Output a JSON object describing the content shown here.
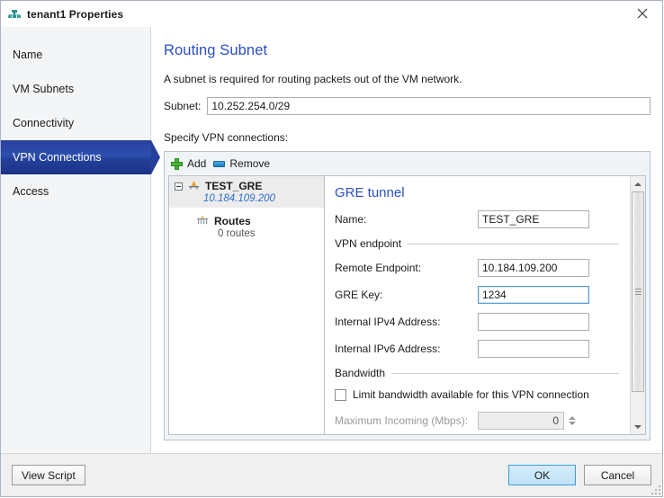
{
  "window": {
    "title": "tenant1 Properties",
    "icon": "network-tenant-icon",
    "close_label": "✕"
  },
  "sidebar": {
    "items": [
      {
        "label": "Name",
        "selected": false
      },
      {
        "label": "VM Subnets",
        "selected": false
      },
      {
        "label": "Connectivity",
        "selected": false
      },
      {
        "label": "VPN Connections",
        "selected": true
      },
      {
        "label": "Access",
        "selected": false
      }
    ]
  },
  "main": {
    "title": "Routing Subnet",
    "description": "A subnet is required for routing packets out of the VM network.",
    "subnet_label": "Subnet:",
    "subnet_value": "10.252.254.0/29",
    "specify_label": "Specify VPN connections:",
    "toolbar": {
      "add_label": "Add",
      "add_icon": "plus-icon",
      "remove_label": "Remove",
      "remove_icon": "minus-icon"
    },
    "tree": {
      "root": {
        "label": "TEST_GRE",
        "sub": "10.184.109.200",
        "selected": true,
        "icon": "vpn-tunnel-icon",
        "expander": "collapse-expander"
      },
      "child": {
        "label": "Routes",
        "sub": "0 routes",
        "icon": "routes-icon"
      }
    },
    "detail": {
      "title": "GRE tunnel",
      "name_label": "Name:",
      "name_value": "TEST_GRE",
      "endpoint_group": "VPN endpoint",
      "remote_label": "Remote Endpoint:",
      "remote_value": "10.184.109.200",
      "gre_key_label": "GRE Key:",
      "gre_key_value": "1234",
      "ipv4_label": "Internal IPv4 Address:",
      "ipv4_value": "",
      "ipv6_label": "Internal IPv6 Address:",
      "ipv6_value": "",
      "bandwidth_group": "Bandwidth",
      "limit_checkbox_label": "Limit bandwidth available for this VPN connection",
      "limit_checked": false,
      "max_incoming_label": "Maximum Incoming (Mbps):",
      "max_incoming_value": "0"
    }
  },
  "footer": {
    "view_script": "View Script",
    "ok": "OK",
    "cancel": "Cancel"
  },
  "colors": {
    "accent_blue": "#2a4fc4",
    "selected_nav": "#24409b",
    "link_blue": "#2f6fd0",
    "add_green": "#4cb03c",
    "primary_btn": "#bfe2f8"
  }
}
